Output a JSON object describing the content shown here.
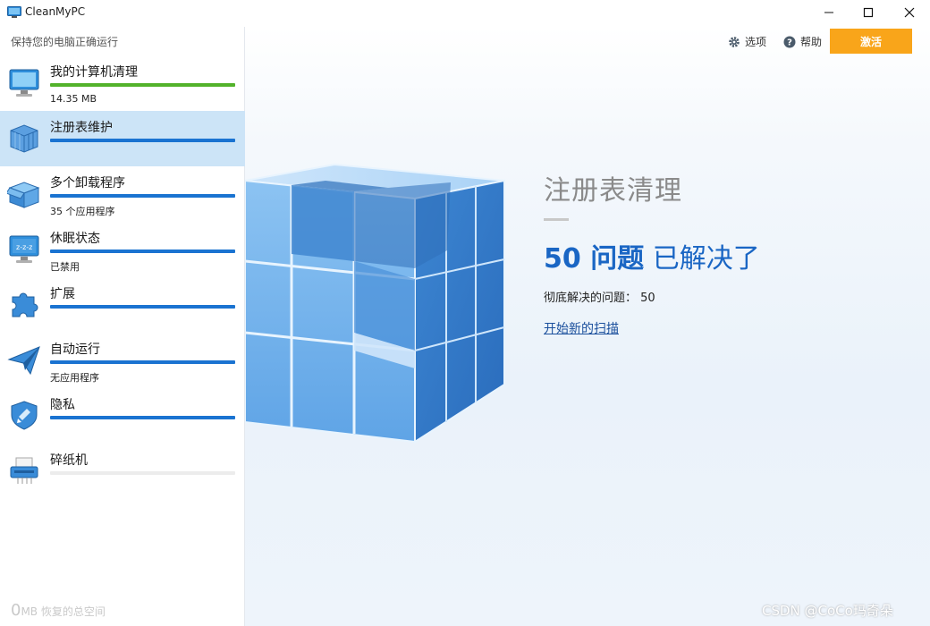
{
  "window": {
    "title": "CleanMyPC",
    "minimize_glyph": "—",
    "maximize_glyph": "☐",
    "close_glyph": "✕"
  },
  "sidebar": {
    "subtitle": "保持您的电脑正确运行",
    "items": [
      {
        "label": "我的计算机清理",
        "sub": "14.35 MB",
        "icon": "monitor-icon",
        "progress": 1.0,
        "bar_color": "#52b22a"
      },
      {
        "label": "注册表维护",
        "sub": "",
        "icon": "registry-cube-icon",
        "progress": 1.0,
        "bar_color": "#1a73d1",
        "active": true
      },
      {
        "label": "多个卸载程序",
        "sub": "35 个应用程序",
        "icon": "box-icon",
        "progress": 1.0,
        "bar_color": "#1a73d1"
      },
      {
        "label": "休眠状态",
        "sub": "已禁用",
        "icon": "sleep-monitor-icon",
        "progress": 1.0,
        "bar_color": "#1a73d1"
      },
      {
        "label": "扩展",
        "sub": "",
        "icon": "puzzle-icon",
        "progress": 1.0,
        "bar_color": "#1a73d1"
      },
      {
        "label": "自动运行",
        "sub": "无应用程序",
        "icon": "paper-plane-icon",
        "progress": 1.0,
        "bar_color": "#1a73d1"
      },
      {
        "label": "隐私",
        "sub": "",
        "icon": "shield-icon",
        "progress": 1.0,
        "bar_color": "#1a73d1"
      },
      {
        "label": "碎纸机",
        "sub": "",
        "icon": "shredder-icon",
        "progress": 0.0,
        "bar_color": "#ececec"
      }
    ],
    "footer_number": "0",
    "footer_text": "MB 恢复的总空间"
  },
  "topbar": {
    "options_label": "选项",
    "help_label": "帮助",
    "activate_label": "激活"
  },
  "result": {
    "title": "注册表清理",
    "count": "50 问题",
    "solved": "已解决了",
    "detail": "彻底解决的问题： 50",
    "new_scan": "开始新的扫描"
  },
  "watermark": "CSDN @CoCo玛奇朵",
  "colors": {
    "accent_blue": "#1a66c4",
    "activate_orange": "#f9a51a",
    "active_item_bg": "#cce4f7",
    "green_bar": "#52b22a"
  }
}
